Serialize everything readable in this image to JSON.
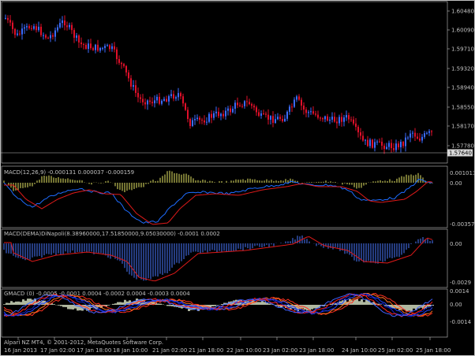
{
  "colors": {
    "background": "#000000",
    "grid": "#c0c0c0",
    "bull": "#3b6cff",
    "bear": "#e0102a",
    "signal": "#e01a1a",
    "macd_line": "#1e6cff",
    "hist_yellow": "#e8e866",
    "hist_blue": "#4a78ff",
    "gmacd_fill": "#b0b8a0",
    "price_box": "#d8d8d8"
  },
  "price_panel": {
    "axis": [
      "1.60480",
      "1.60090",
      "1.59710",
      "1.59320",
      "1.58940",
      "1.58550",
      "1.58170",
      "1.57780",
      "1.57400"
    ],
    "current_price": "1.57640",
    "open_series_shape": "candles"
  },
  "macd_panel": {
    "title": "MACD(12,26,9) -0.000131 0.000037 -0.000159",
    "axis": [
      "0.001013",
      "0.00",
      "-0.003572"
    ]
  },
  "dinapoli_panel": {
    "title": "MACD(DEMA)DiNapoli(8.38960000,17.51850000,9.05030000) -0.0001 0.0002",
    "axis": [
      "0.00",
      "-0.0029"
    ]
  },
  "gmacd_panel": {
    "title": "GMACD  (0) -0.0005 -0.0001 0.0004 -0.0002 0.0004 -0.0003 0.0004",
    "axis": [
      "0.0014",
      "0.00",
      "-0.0014"
    ]
  },
  "time_axis": [
    "16 Jan 2013",
    "17 Jan 02:00",
    "17 Jan 18:00",
    "18 Jan 10:00",
    "21 Jan 02:00",
    "21 Jan 18:00",
    "22 Jan 10:00",
    "23 Jan 02:00",
    "23 Jan 18:00",
    "24 Jan 10:00",
    "25 Jan 02:00",
    "25 Jan 18:00"
  ],
  "copyright": "Alpari NZ MT4, © 2001-2012, MetaQuotes Software Corp."
}
